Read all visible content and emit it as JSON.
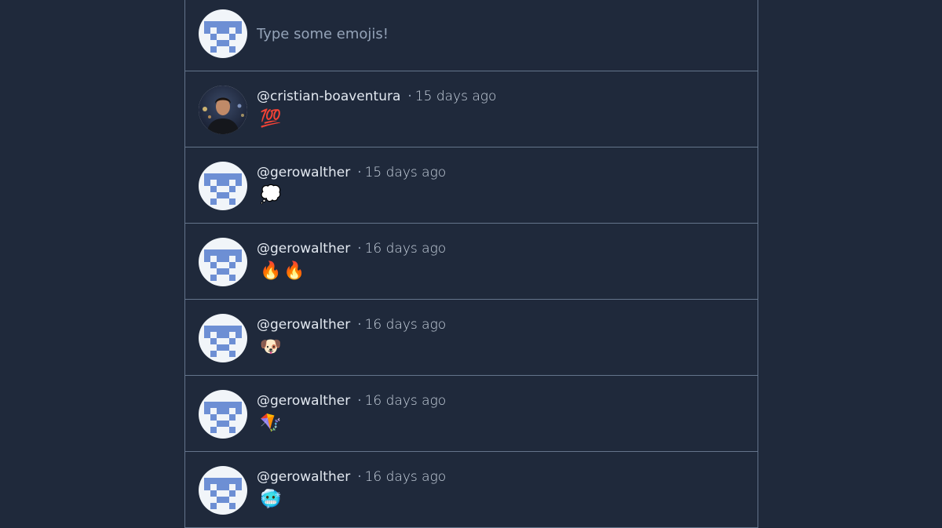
{
  "composer": {
    "placeholder": "Type some emojis!",
    "avatar": "identicon"
  },
  "posts": [
    {
      "author": "@cristian-boaventura",
      "separator": "·",
      "time": "15 days ago",
      "emojis": "💯",
      "avatar": "photo"
    },
    {
      "author": "@gerowalther",
      "separator": "·",
      "time": "15 days ago",
      "emojis": "💭",
      "avatar": "identicon"
    },
    {
      "author": "@gerowalther",
      "separator": "·",
      "time": "16 days ago",
      "emojis": "🔥🔥",
      "avatar": "identicon"
    },
    {
      "author": "@gerowalther",
      "separator": "·",
      "time": "16 days ago",
      "emojis": "🐶",
      "avatar": "identicon"
    },
    {
      "author": "@gerowalther",
      "separator": "·",
      "time": "16 days ago",
      "emojis": "🪁",
      "avatar": "identicon"
    },
    {
      "author": "@gerowalther",
      "separator": "·",
      "time": "16 days ago",
      "emojis": "🥶",
      "avatar": "identicon"
    }
  ],
  "colors": {
    "background": "#1f293b",
    "divider": "#64748b",
    "identicon": "#6d8fd4",
    "avatar_bg": "#f1f5f9"
  }
}
